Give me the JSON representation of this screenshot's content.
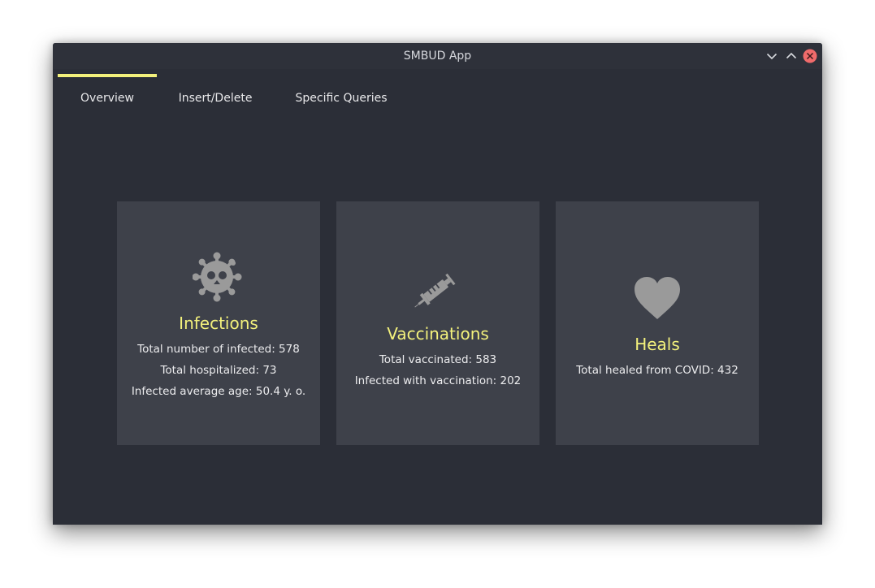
{
  "window": {
    "title": "SMBUD App"
  },
  "tabs": [
    {
      "label": "Overview",
      "active": true
    },
    {
      "label": "Insert/Delete",
      "active": false
    },
    {
      "label": "Specific Queries",
      "active": false
    }
  ],
  "cards": {
    "infections": {
      "icon": "virus-skull-icon",
      "title": "Infections",
      "stats": [
        "Total number of infected: 578",
        "Total hospitalized: 73",
        "Infected average age: 50.4 y. o."
      ]
    },
    "vaccinations": {
      "icon": "syringe-icon",
      "title": "Vaccinations",
      "stats": [
        "Total vaccinated: 583",
        "Infected with vaccination: 202"
      ]
    },
    "heals": {
      "icon": "heart-icon",
      "title": "Heals",
      "stats": [
        "Total healed from COVID: 432"
      ]
    }
  },
  "colors": {
    "background": "#2b2e37",
    "card": "#3e414a",
    "accent": "#f3f17c",
    "icon": "#9a9a9a",
    "close": "#f06b6b"
  }
}
